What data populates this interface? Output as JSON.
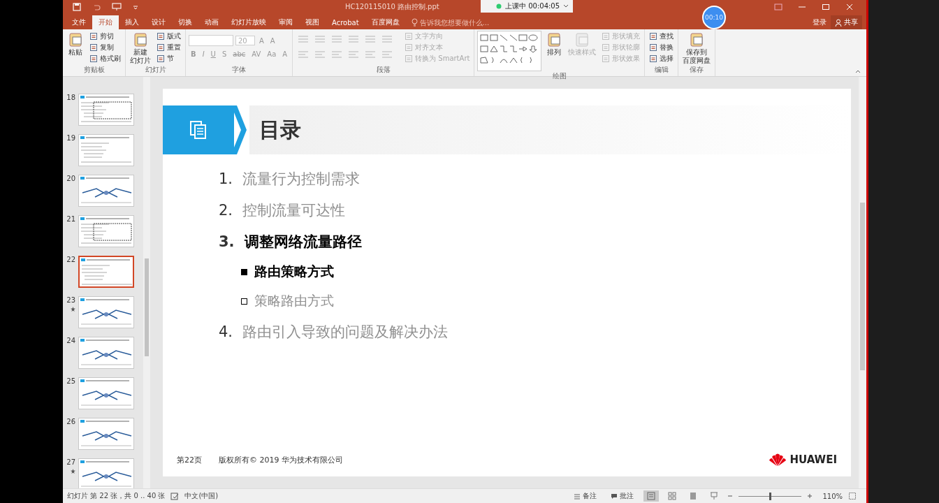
{
  "window": {
    "title": "HC120115010  路由控制.ppt"
  },
  "class_overlay": {
    "status": "上课中 00:04:05"
  },
  "timer": {
    "text": "00:10"
  },
  "tabs": [
    {
      "label": "文件",
      "selected": false
    },
    {
      "label": "开始",
      "selected": true
    },
    {
      "label": "插入",
      "selected": false
    },
    {
      "label": "设计",
      "selected": false
    },
    {
      "label": "切换",
      "selected": false
    },
    {
      "label": "动画",
      "selected": false
    },
    {
      "label": "幻灯片放映",
      "selected": false
    },
    {
      "label": "审阅",
      "selected": false
    },
    {
      "label": "视图",
      "selected": false
    },
    {
      "label": "Acrobat",
      "selected": false
    },
    {
      "label": "百度网盘",
      "selected": false
    }
  ],
  "tell_me": {
    "placeholder": "告诉我您想要做什么..."
  },
  "account": {
    "sign_in": "登录",
    "share": "共享"
  },
  "ribbon": {
    "groups": [
      {
        "kind": "buttons",
        "label": "剪贴板",
        "large": [
          {
            "lines": [
              "粘贴"
            ],
            "disabled": false
          }
        ],
        "small": [
          {
            "label": "剪切",
            "disabled": false
          },
          {
            "label": "复制",
            "disabled": false
          },
          {
            "label": "格式刷",
            "disabled": false
          }
        ]
      },
      {
        "kind": "buttons",
        "label": "幻灯片",
        "large": [
          {
            "lines": [
              "新建",
              "幻灯片"
            ],
            "disabled": false
          }
        ],
        "small": [
          {
            "label": "版式",
            "disabled": false
          },
          {
            "label": "重置",
            "disabled": false
          },
          {
            "label": "节",
            "disabled": false
          }
        ]
      },
      {
        "kind": "font",
        "label": "字体",
        "size": "20",
        "grow_shrink": [
          "A",
          "A"
        ],
        "format": [
          "B",
          "I",
          "U",
          "S",
          "abc",
          "AV",
          "Aa",
          "A"
        ]
      },
      {
        "kind": "paragraph",
        "label": "段落",
        "small": [
          {
            "label": "文字方向",
            "disabled": true
          },
          {
            "label": "对齐文本",
            "disabled": true
          },
          {
            "label": "转换为 SmartArt",
            "disabled": true
          }
        ]
      },
      {
        "kind": "drawing",
        "label": "绘图",
        "large": [
          {
            "lines": [
              "排列"
            ],
            "disabled": false
          },
          {
            "lines": [
              "快速样式"
            ],
            "disabled": true
          }
        ],
        "small": [
          {
            "label": "形状填充",
            "disabled": true
          },
          {
            "label": "形状轮廓",
            "disabled": true
          },
          {
            "label": "形状效果",
            "disabled": true
          }
        ]
      },
      {
        "kind": "buttons",
        "label": "编辑",
        "small": [
          {
            "label": "查找",
            "disabled": false
          },
          {
            "label": "替换",
            "disabled": false
          },
          {
            "label": "选择",
            "disabled": false
          }
        ]
      },
      {
        "kind": "buttons",
        "label": "保存",
        "large": [
          {
            "lines": [
              "保存到",
              "百度网盘"
            ],
            "disabled": false
          }
        ]
      }
    ]
  },
  "thumbnails": [
    {
      "number": "18",
      "selected": false,
      "starred": false
    },
    {
      "number": "19",
      "selected": false,
      "starred": false
    },
    {
      "number": "20",
      "selected": false,
      "starred": false
    },
    {
      "number": "21",
      "selected": false,
      "starred": false
    },
    {
      "number": "22",
      "selected": true,
      "starred": false
    },
    {
      "number": "23",
      "selected": false,
      "starred": true
    },
    {
      "number": "24",
      "selected": false,
      "starred": false
    },
    {
      "number": "25",
      "selected": false,
      "starred": false
    },
    {
      "number": "26",
      "selected": false,
      "starred": false
    },
    {
      "number": "27",
      "selected": false,
      "starred": true
    }
  ],
  "slide": {
    "title": "目录",
    "items": [
      {
        "kind": "item",
        "marker": "1.",
        "text": "流量行为控制需求",
        "current": false
      },
      {
        "kind": "item",
        "marker": "2.",
        "text": "控制流量可达性",
        "current": false
      },
      {
        "kind": "item",
        "marker": "3.",
        "text": "调整网络流量路径",
        "current": true
      },
      {
        "kind": "subitem",
        "text": "路由策略方式",
        "current": true
      },
      {
        "kind": "subitem",
        "text": "策略路由方式",
        "current": false
      },
      {
        "kind": "item",
        "marker": "4.",
        "text": "路由引入导致的问题及解决办法",
        "current": false
      }
    ],
    "page": "第22页",
    "copyright": "版权所有© 2019 华为技术有限公司",
    "logo": "HUAWEI"
  },
  "status_bar": {
    "slide_info": "幻灯片 第 22 张，共 0 .. 40 张",
    "language": "中文(中国)",
    "notes": "备注",
    "comments": "批注",
    "zoom": {
      "level": 0.5
    },
    "zoom_text": "110%"
  }
}
